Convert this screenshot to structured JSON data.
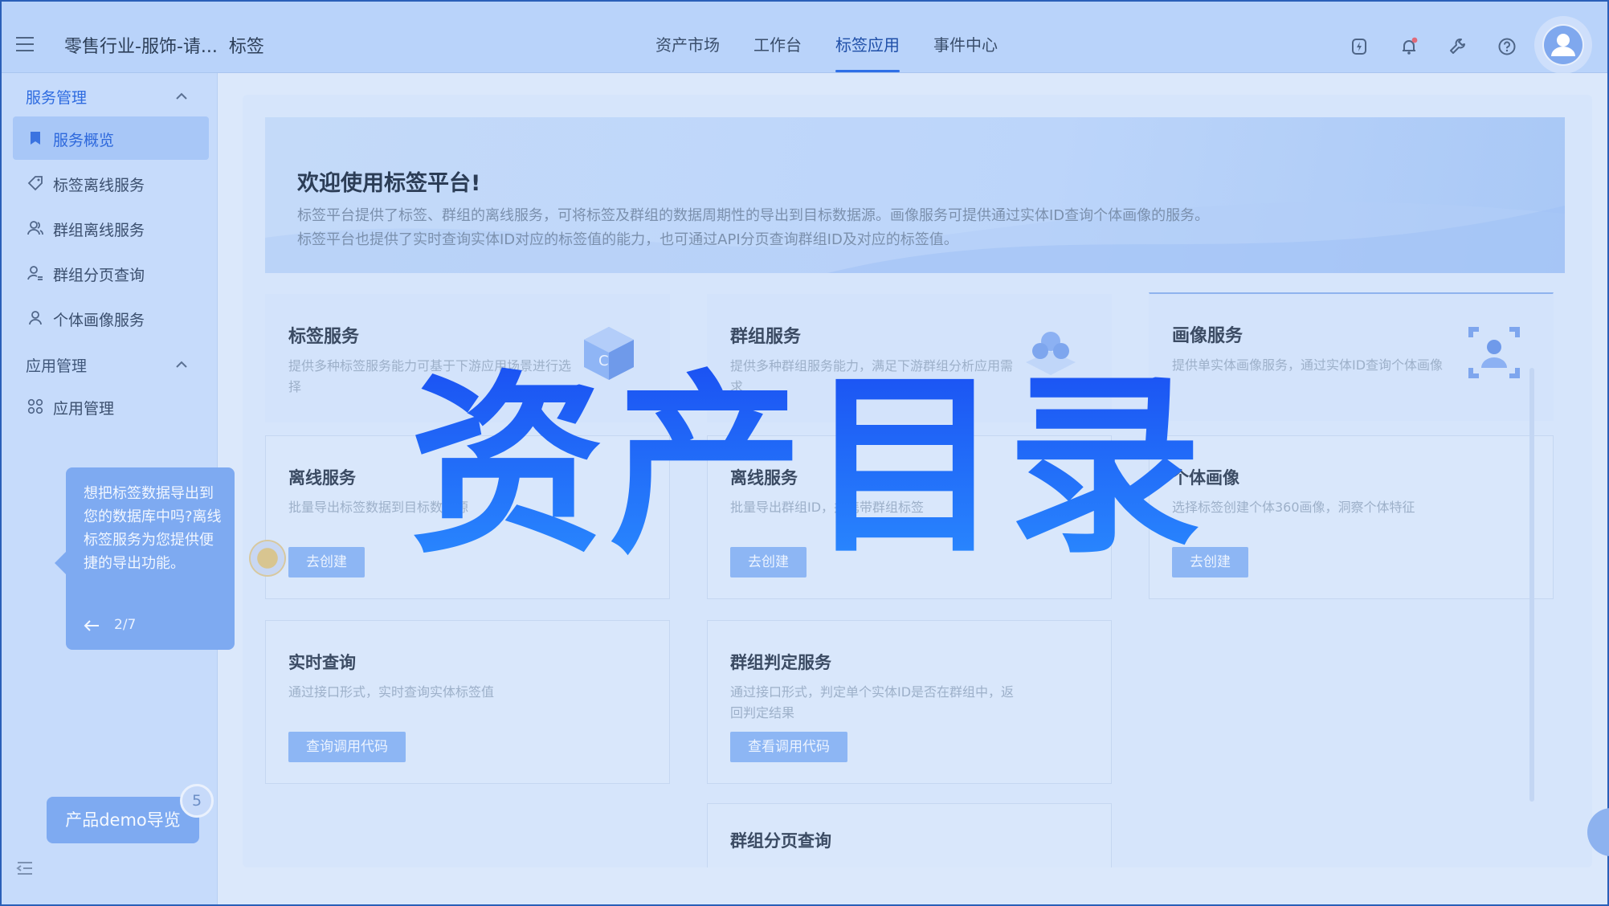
{
  "header": {
    "breadcrumb_project": "零售行业-服饰-请...",
    "breadcrumb_current": "标签",
    "nav_tabs": [
      "资产市场",
      "工作台",
      "标签应用",
      "事件中心"
    ],
    "active_tab": "标签应用",
    "icons": [
      "lightning-icon",
      "bell-icon",
      "wrench-icon",
      "help-icon",
      "avatar"
    ]
  },
  "sidebar": {
    "groups": [
      {
        "label": "服务管理",
        "items": [
          {
            "label": "服务概览",
            "icon": "bookmark-icon",
            "active": true
          },
          {
            "label": "标签离线服务",
            "icon": "tag-icon"
          },
          {
            "label": "群组离线服务",
            "icon": "users-icon"
          },
          {
            "label": "群组分页查询",
            "icon": "user-search-icon"
          },
          {
            "label": "个体画像服务",
            "icon": "user-icon"
          }
        ]
      },
      {
        "label": "应用管理",
        "items": [
          {
            "label": "应用管理",
            "icon": "grid-icon"
          }
        ]
      }
    ]
  },
  "banner": {
    "title": "欢迎使用标签平台!",
    "line1": "标签平台提供了标签、群组的离线服务，可将标签及群组的数据周期性的导出到目标数据源。画像服务可提供通过实体ID查询个体画像的服务。",
    "line2": "标签平台也提供了实时查询实体ID对应的标签值的能力，也可通过API分页查询群组ID及对应的标签值。"
  },
  "columns": [
    {
      "title": "标签服务",
      "desc": "提供多种标签服务能力可基于下游应用场景进行选择",
      "cards": [
        {
          "title": "离线服务",
          "desc": "批量导出标签数据到目标数据源",
          "button": "去创建"
        },
        {
          "title": "实时查询",
          "desc": "通过接口形式，实时查询实体标签值",
          "button": "查询调用代码"
        }
      ]
    },
    {
      "title": "群组服务",
      "desc": "提供多种群组服务能力，满足下游群组分析应用需求",
      "cards": [
        {
          "title": "离线服务",
          "desc": "批量导出群组ID，并携带群组标签",
          "button": "去创建"
        },
        {
          "title": "群组判定服务",
          "desc": "通过接口形式，判定单个实体ID是否在群组中，返回判定结果",
          "button": "查看调用代码"
        },
        {
          "title": "群组分页查询"
        }
      ]
    },
    {
      "title": "画像服务",
      "desc": "提供单实体画像服务，通过实体ID查询个体画像",
      "cards": [
        {
          "title": "个体画像",
          "desc": "选择标签创建个体360画像，洞察个体特征",
          "button": "去创建"
        }
      ]
    }
  ],
  "overlay": {
    "headline": "资产目录",
    "color_top": "#1a4ff2",
    "color_bottom": "#2a8cff"
  },
  "guide": {
    "text": "想把标签数据导出到您的数据库中吗?离线标签服务为您提供便捷的导出功能。",
    "step": "2/7"
  },
  "demo": {
    "label": "产品demo导览",
    "badge": "5"
  },
  "colors": {
    "accent": "#2f6fe6",
    "button": "#8db6f4",
    "tooltip": "#7eaaf1"
  }
}
